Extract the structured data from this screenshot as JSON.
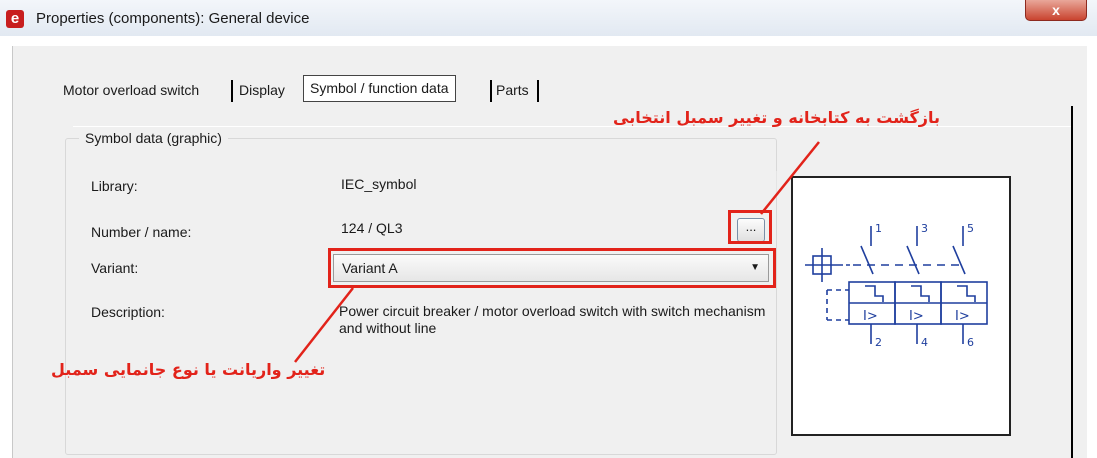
{
  "window": {
    "title": "Properties (components): General device",
    "app_icon": "e",
    "close_label": "x"
  },
  "tabs": [
    {
      "label": "Motor overload switch"
    },
    {
      "label": "Display"
    },
    {
      "label": "Symbol / function data"
    },
    {
      "label": "Parts"
    }
  ],
  "active_tab": 2,
  "group": {
    "title": "Symbol data (graphic)",
    "library": {
      "label": "Library:",
      "value": "IEC_symbol"
    },
    "number": {
      "label": "Number / name:",
      "value": "124 / QL3",
      "browse": "..."
    },
    "variant": {
      "label": "Variant:",
      "value": "Variant A"
    },
    "description": {
      "label": "Description:",
      "value": "Power circuit breaker / motor overload switch with switch mechanism and without line"
    }
  },
  "symbol_preview": {
    "top_terminals": [
      "1",
      "3",
      "5"
    ],
    "bottom_terminals": [
      "2",
      "4",
      "6"
    ],
    "trip_labels": [
      "I>",
      "I>",
      "I>"
    ]
  },
  "annotations": {
    "top": "بازگشت به کتابخانه و تغییر سمبل انتخابی",
    "bottom": "تغییر واریانت یا نوع جانمایی سمبل"
  },
  "colors": {
    "accent": "#e2231a"
  }
}
